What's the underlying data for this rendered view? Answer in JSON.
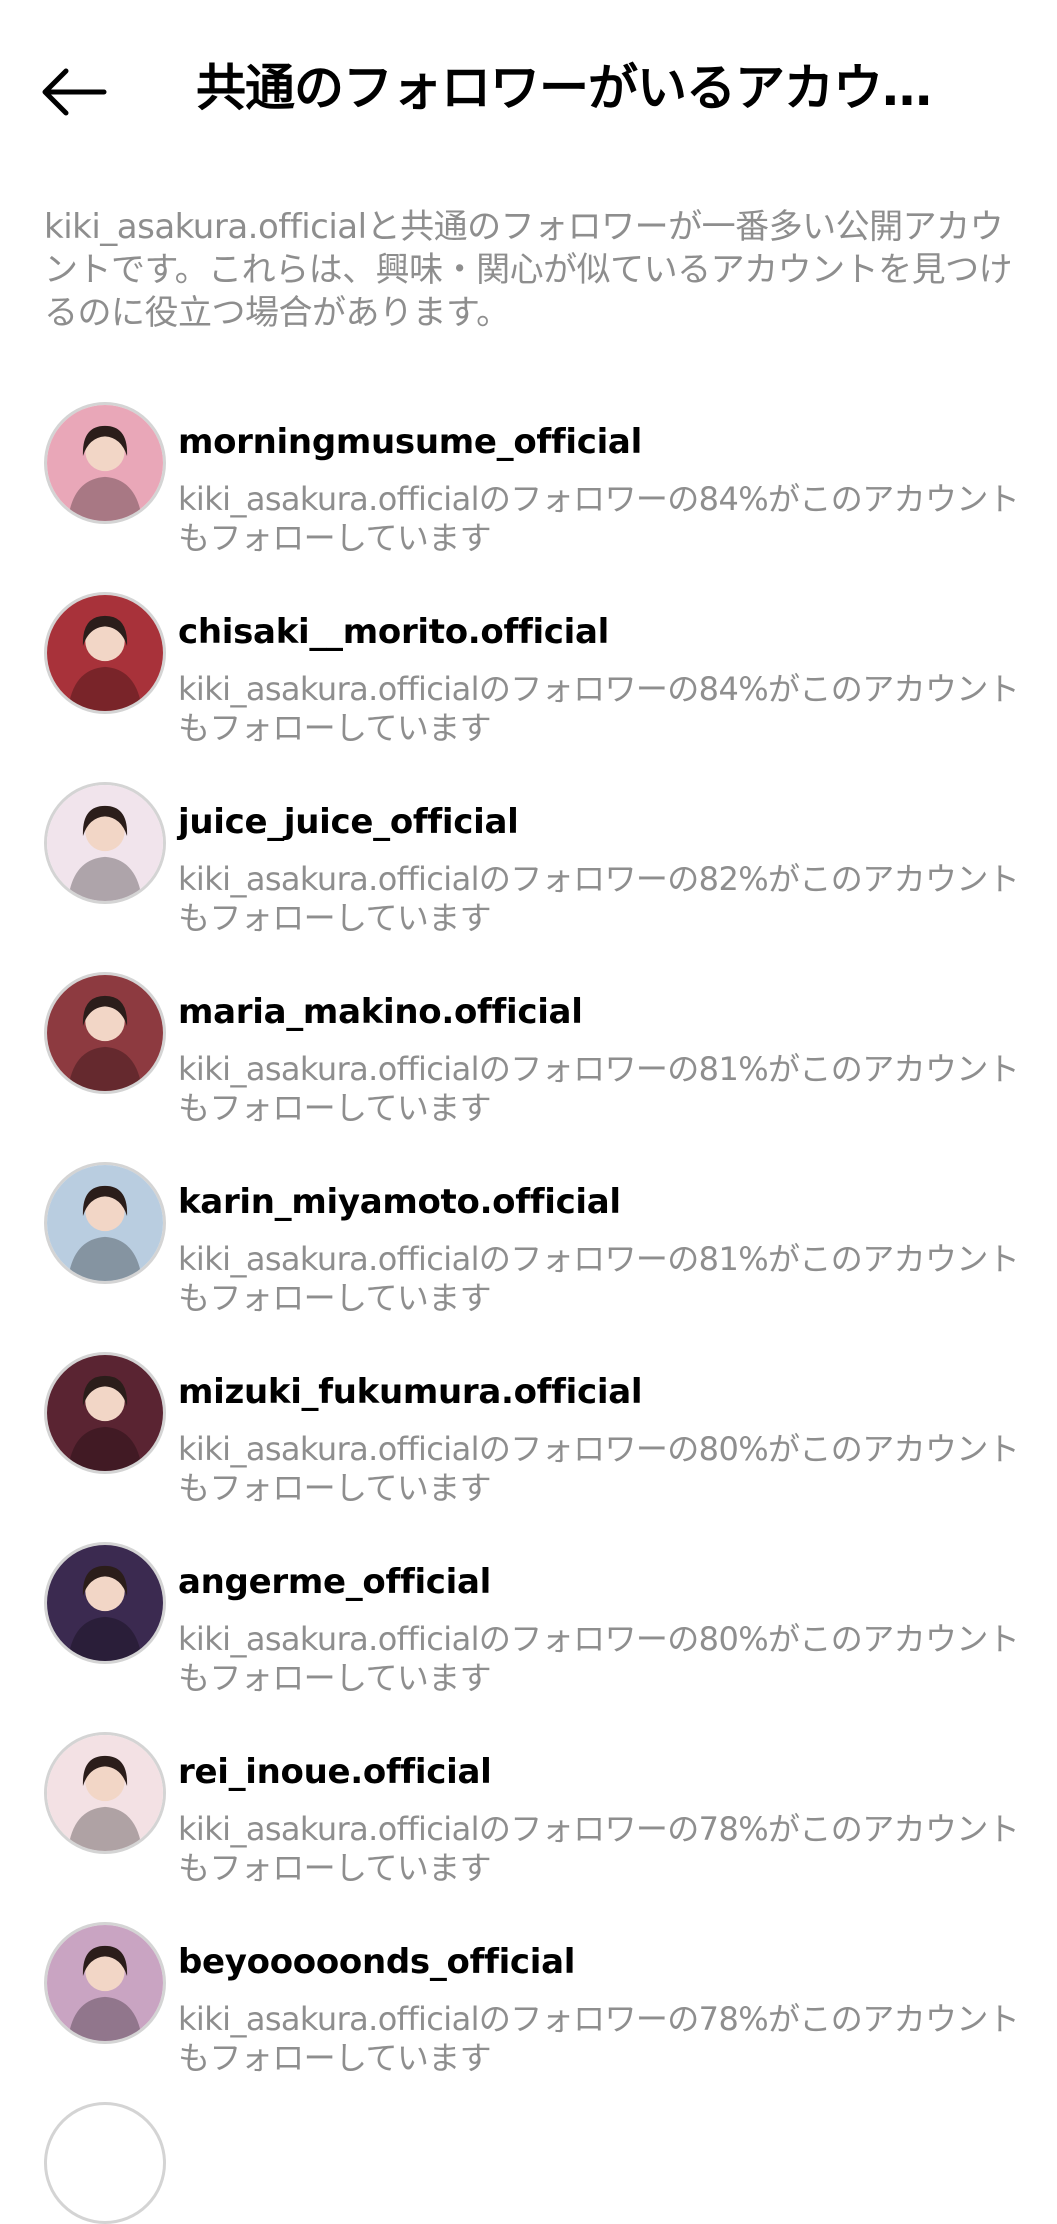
{
  "header": {
    "title": "共通のフォロワーがいるアカウ…",
    "back_icon": "arrow-left-icon"
  },
  "description": "kiki_asakura.officialと共通のフォロワーが一番多い公開アカウントです。これらは、興味・関心が似ているアカウントを見つけるのに役立つ場合があります。",
  "accounts": [
    {
      "username": "morningmusume_official",
      "subtitle": "kiki_asakura.officialのフォロワーの84%がこのアカウントもフォローしています",
      "avatar_color": "#e9a7b8"
    },
    {
      "username": "chisaki__morito.official",
      "subtitle": "kiki_asakura.officialのフォロワーの84%がこのアカウントもフォローしています",
      "avatar_color": "#a8323a"
    },
    {
      "username": "juice_juice_official",
      "subtitle": "kiki_asakura.officialのフォロワーの82%がこのアカウントもフォローしています",
      "avatar_color": "#f1e4ec"
    },
    {
      "username": "maria_makino.official",
      "subtitle": "kiki_asakura.officialのフォロワーの81%がこのアカウントもフォローしています",
      "avatar_color": "#8d3a40"
    },
    {
      "username": "karin_miyamoto.official",
      "subtitle": "kiki_asakura.officialのフォロワーの81%がこのアカウントもフォローしています",
      "avatar_color": "#b9cde0"
    },
    {
      "username": "mizuki_fukumura.official",
      "subtitle": "kiki_asakura.officialのフォロワーの80%がこのアカウントもフォローしています",
      "avatar_color": "#5a2432"
    },
    {
      "username": "angerme_official",
      "subtitle": "kiki_asakura.officialのフォロワーの80%がこのアカウントもフォローしています",
      "avatar_color": "#3b2a50"
    },
    {
      "username": "rei_inoue.official",
      "subtitle": "kiki_asakura.officialのフォロワーの78%がこのアカウントもフォローしています",
      "avatar_color": "#f3e1e4"
    },
    {
      "username": "beyooooonds_official",
      "subtitle": "kiki_asakura.officialのフォロワーの78%がこのアカウントもフォローしています",
      "avatar_color": "#c9a4c2"
    }
  ]
}
